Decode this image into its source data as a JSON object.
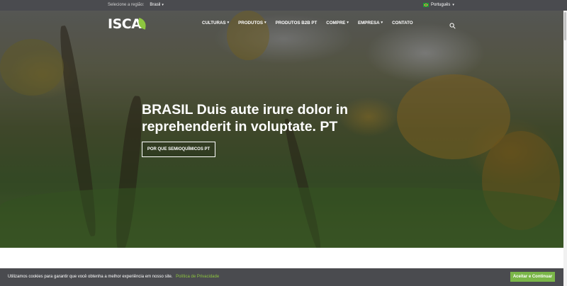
{
  "topbar": {
    "region_label": "Selecione a região:",
    "region_value": "Brasil",
    "language": "Português"
  },
  "logo": {
    "text": "ISCA"
  },
  "nav": {
    "items": [
      {
        "label": "CULTURAS",
        "dropdown": true
      },
      {
        "label": "PRODUTOS",
        "dropdown": true
      },
      {
        "label": "PRODUTOS B2B PT",
        "dropdown": false
      },
      {
        "label": "COMPRE",
        "dropdown": true
      },
      {
        "label": "EMPRESA",
        "dropdown": true
      },
      {
        "label": "CONTATO",
        "dropdown": false
      }
    ]
  },
  "hero": {
    "title": "BRASIL Duis aute irure dolor in reprehenderit in voluptate. PT",
    "button_label": "POR QUE SEMIOQUÍMICOS PT"
  },
  "cookie": {
    "message": "Utilizamos cookies para garantir que você obtenha a melhor experiência em nosso site.",
    "policy_link": "Política de Privacidade",
    "accept_label": "Aceitar e Continuar"
  },
  "colors": {
    "topbar_bg": "#4a4b4f",
    "brand_green": "#7ab648",
    "logo_leaf": "#8dc63f"
  },
  "icons": {
    "search": "search-icon",
    "flag": "brazil-flag-icon"
  }
}
